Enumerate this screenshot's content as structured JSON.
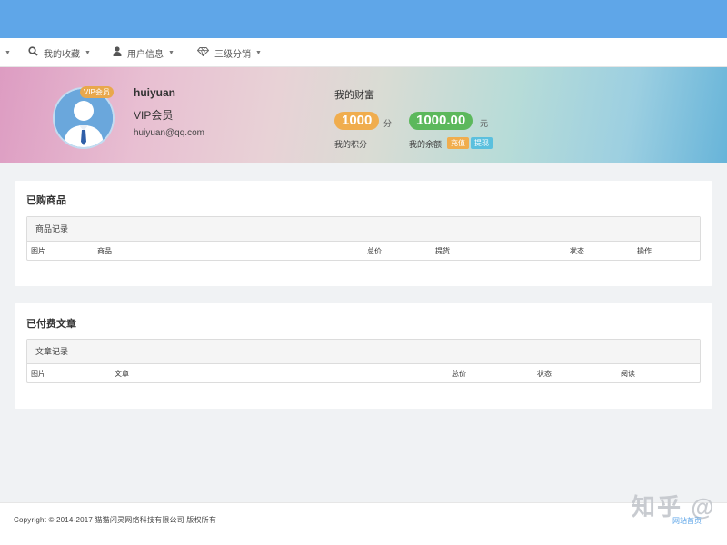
{
  "nav": {
    "items": [
      {
        "label": "我的收藏",
        "icon": "search-icon"
      },
      {
        "label": "用户信息",
        "icon": "user-icon"
      },
      {
        "label": "三级分销",
        "icon": "diamond-icon"
      }
    ]
  },
  "profile": {
    "vip_badge": "VIP会员",
    "username": "huiyuan",
    "level": "VIP会员",
    "email": "huiyuan@qq.com"
  },
  "wealth": {
    "title": "我的财富",
    "points_value": "1000",
    "points_unit": "分",
    "points_label": "我的积分",
    "balance_value": "1000.00",
    "balance_unit": "元",
    "balance_label": "我的余额",
    "recharge_label": "充值",
    "withdraw_label": "提现"
  },
  "purchased": {
    "title": "已购商品",
    "panel_title": "商品记录",
    "columns": [
      "图片",
      "商品",
      "总价",
      "提货",
      "状态",
      "操作"
    ]
  },
  "articles": {
    "title": "已付费文章",
    "panel_title": "文章记录",
    "columns": [
      "图片",
      "文章",
      "总价",
      "状态",
      "阅读"
    ]
  },
  "footer": {
    "copyright": "Copyright © 2014-2017 猫猫闪灵网络科技有限公司 版权所有",
    "home_link": "网站首页",
    "watermark": "知乎 @"
  },
  "colors": {
    "topbar": "#5fa6e8",
    "points": "#f0ad4e",
    "balance": "#5cb85c",
    "recharge": "#f0ad4e",
    "withdraw": "#5bc0de"
  }
}
